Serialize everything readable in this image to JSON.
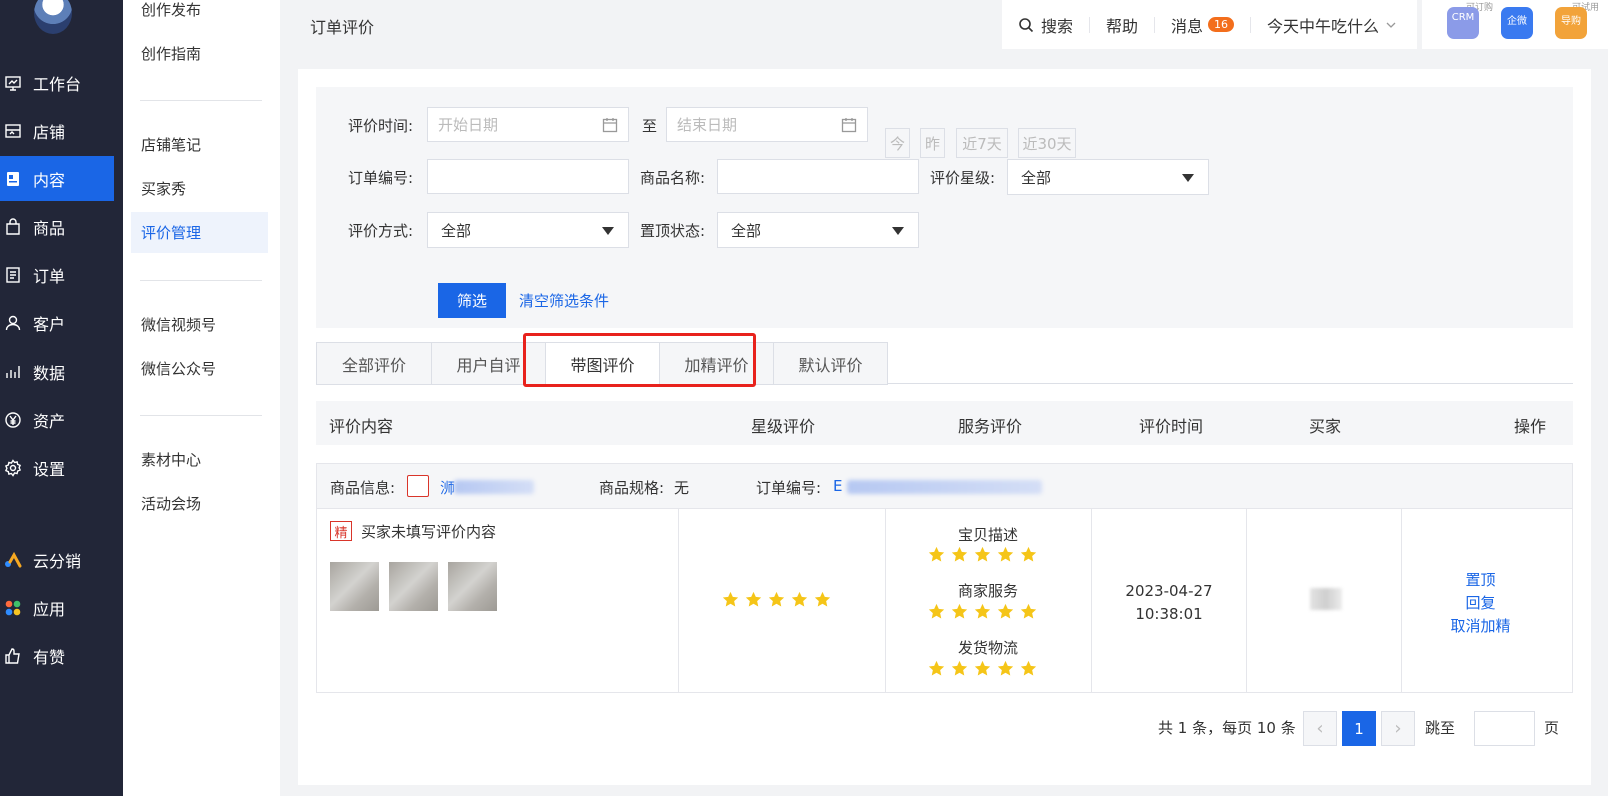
{
  "nav1": {
    "items": [
      {
        "label": "工作台",
        "icon": "dashboard-icon"
      },
      {
        "label": "店铺",
        "icon": "shop-icon"
      },
      {
        "label": "内容",
        "icon": "content-icon"
      },
      {
        "label": "商品",
        "icon": "bag-icon"
      },
      {
        "label": "订单",
        "icon": "order-icon"
      },
      {
        "label": "客户",
        "icon": "user-icon"
      },
      {
        "label": "数据",
        "icon": "chart-icon"
      },
      {
        "label": "资产",
        "icon": "yen-icon"
      },
      {
        "label": "设置",
        "icon": "gear-icon"
      },
      {
        "label": "云分销",
        "icon": "distribution-icon"
      },
      {
        "label": "应用",
        "icon": "apps-icon"
      },
      {
        "label": "有赞",
        "icon": "thumb-up-icon"
      }
    ],
    "active": "内容"
  },
  "nav2": {
    "items": [
      "创作发布",
      "创作指南",
      "店铺笔记",
      "买家秀",
      "评价管理",
      "微信视频号",
      "微信公众号",
      "素材中心",
      "活动会场"
    ],
    "active": "评价管理"
  },
  "header": {
    "page_title": "订单评价",
    "search": "搜索",
    "help": "帮助",
    "messages": "消息",
    "message_count": "16",
    "store_name": "今天中午吃什么",
    "apps": [
      {
        "label": "CRM",
        "tag": "可订购",
        "color": "#8b9be8"
      },
      {
        "label": "企微",
        "tag": "",
        "color": "#3a7af0"
      },
      {
        "label": "导购",
        "tag": "可试用",
        "color": "#f2a33a"
      }
    ]
  },
  "filter": {
    "time_label": "评价时间:",
    "start_placeholder": "开始日期",
    "to": "至",
    "end_placeholder": "结束日期",
    "quick": [
      "今",
      "昨",
      "近7天",
      "近30天"
    ],
    "order_no_label": "订单编号:",
    "product_name_label": "商品名称:",
    "rating_label": "评价星级:",
    "rating_value": "全部",
    "method_label": "评价方式:",
    "method_value": "全部",
    "pin_label": "置顶状态:",
    "pin_value": "全部",
    "submit": "筛选",
    "clear": "清空筛选条件"
  },
  "tabs": [
    "全部评价",
    "用户自评",
    "带图评价",
    "加精评价",
    "默认评价"
  ],
  "active_tab": "带图评价",
  "table": {
    "headers": [
      "评价内容",
      "星级评价",
      "服务评价",
      "评价时间",
      "买家",
      "操作"
    ]
  },
  "order": {
    "product_info_label": "商品信息:",
    "product_name_visible": "浉",
    "spec_label": "商品规格:",
    "spec_value": "无",
    "order_no_label": "订单编号:",
    "order_no_visible": "E",
    "badge": "精",
    "comment": "买家未填写评价内容",
    "star_rating": 5,
    "service": [
      {
        "label": "宝贝描述",
        "stars": 5
      },
      {
        "label": "商家服务",
        "stars": 5
      },
      {
        "label": "发货物流",
        "stars": 5
      }
    ],
    "date": "2023-04-27",
    "time": "10:38:01",
    "actions": [
      "置顶",
      "回复",
      "取消加精"
    ]
  },
  "pagination": {
    "summary": "共 1 条，每页 10 条",
    "current": "1",
    "jump_label": "跳至",
    "page_suffix": "页"
  },
  "colors": {
    "primary": "#1a66e6",
    "nav_bg": "#222638",
    "star": "#f5c518",
    "highlight": "#e8221c"
  }
}
